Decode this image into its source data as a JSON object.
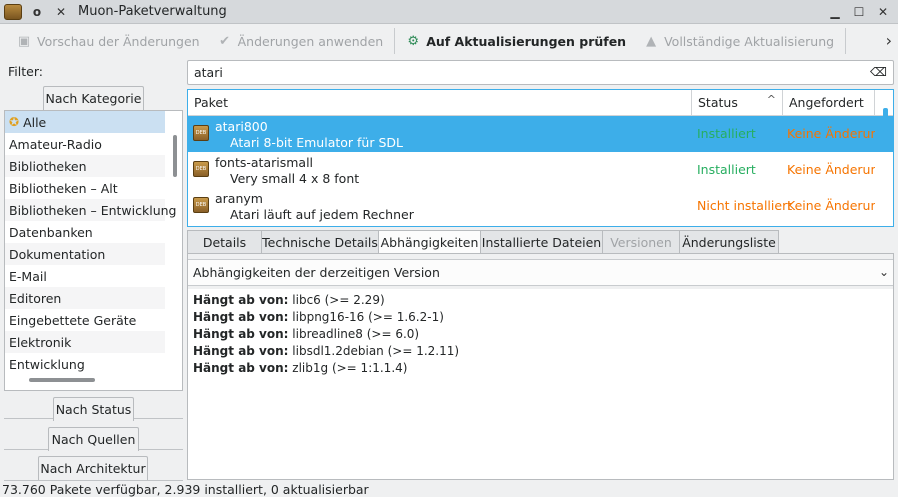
{
  "window": {
    "title": "Muon-Paketverwaltung"
  },
  "toolbar": {
    "preview": "Vorschau der Änderungen",
    "apply": "Änderungen anwenden",
    "check_updates": "Auf Aktualisierungen prüfen",
    "full_upgrade": "Vollständige Aktualisierung"
  },
  "sidebar": {
    "filter_label": "Filter:",
    "category_tab": "Nach Kategorie",
    "categories": [
      "Alle",
      "Amateur-Radio",
      "Bibliotheken",
      "Bibliotheken – Alt",
      "Bibliotheken – Entwicklung",
      "Datenbanken",
      "Dokumentation",
      "E-Mail",
      "Editoren",
      "Eingebettete Geräte",
      "Elektronik",
      "Entwicklung"
    ],
    "by_status": "Nach Status",
    "by_origin": "Nach Quellen",
    "by_arch": "Nach Architektur"
  },
  "search": {
    "value": "atari"
  },
  "package_table": {
    "headers": {
      "package": "Paket",
      "status": "Status",
      "requested": "Angefordert"
    },
    "rows": [
      {
        "name": "atari800",
        "description": "Atari 8-bit Emulator für SDL",
        "status": "Installiert",
        "requested": "Keine Änderung"
      },
      {
        "name": "fonts-atarismall",
        "description": "Very small 4 x 8 font",
        "status": "Installiert",
        "requested": "Keine Änderung"
      },
      {
        "name": "aranym",
        "description": "Atari läuft auf jedem Rechner",
        "status": "Nicht installiert",
        "requested": "Keine Änderung"
      }
    ]
  },
  "detail_tabs": [
    "Details",
    "Technische Details",
    "Abhängigkeiten",
    "Installierte Dateien",
    "Versionen",
    "Änderungsliste"
  ],
  "dependencies": {
    "version_select": "Abhängigkeiten der derzeitigen Version",
    "prefix": "Hängt ab von:",
    "items": [
      "libc6 (>= 2.29)",
      "libpng16-16 (>= 1.6.2-1)",
      "libreadline8 (>= 6.0)",
      "libsdl1.2debian (>= 1.2.11)",
      "zlib1g (>= 1:1.1.4)"
    ]
  },
  "status_bar": {
    "text": "73.760 Pakete verfügbar, 2.939 installiert, 0 aktualisierbar"
  },
  "colors": {
    "selection": "#3daee9",
    "installed": "#27ae60",
    "not_installed_or_no_change": "#f67400"
  }
}
